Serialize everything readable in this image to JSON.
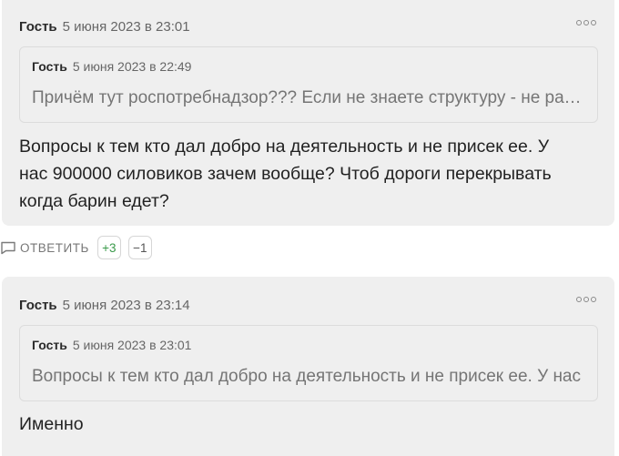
{
  "comments": [
    {
      "author": "Гость",
      "date": "5 июня 2023 в 23:01",
      "more_icon": "more-dots-icon",
      "quote": {
        "author": "Гость",
        "date": "5 июня 2023 в 22:49",
        "text": "Причём тут роспотребнадзор??? Если не знаете структуру - не разбирайтесь"
      },
      "text_lines": [
        "Вопросы к тем кто дал добро на деятельность и не присек ее. У",
        "нас 900000 силовиков зачем вообще? Чтоб дороги перекрывать",
        "когда барин едет?"
      ],
      "actions": {
        "reply_icon": "speech-bubble-icon",
        "reply_label": "ОТВЕТИТЬ",
        "upvotes": "+3",
        "downvotes": "−1"
      }
    },
    {
      "author": "Гость",
      "date": "5 июня 2023 в 23:14",
      "more_icon": "more-dots-icon",
      "quote": {
        "author": "Гость",
        "date": "5 июня 2023 в 23:01",
        "text": "Вопросы к тем кто дал добро на деятельность и не присек ее. У нас"
      },
      "text_lines": [
        "Именно"
      ]
    }
  ]
}
